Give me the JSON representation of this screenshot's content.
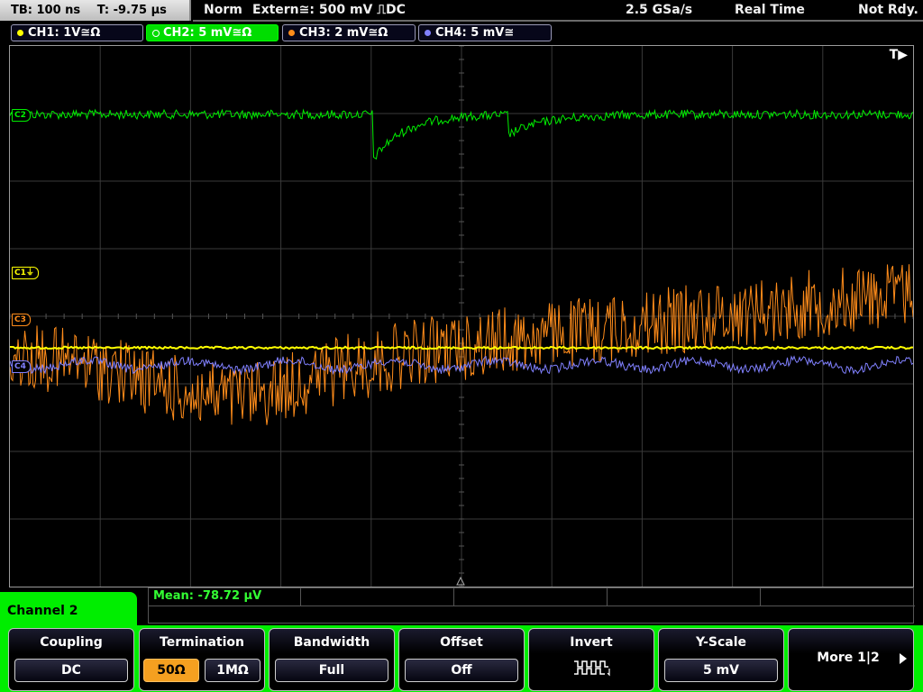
{
  "status": {
    "timebase": "TB: 100 ns",
    "trigger_time": "T: -9.75 µs",
    "trigger_mode": "Norm",
    "trigger_source": "Extern≅: 500 mV ⎍DC",
    "sample_rate": "2.5 GSa/s",
    "acq_mode": "Real Time",
    "state": "Not Rdy."
  },
  "channels": [
    {
      "label": "CH1: 1V≅Ω",
      "color": "#ffff00",
      "active": false
    },
    {
      "label": "CH2: 5 mV≅Ω",
      "color": "#00ee00",
      "active": true
    },
    {
      "label": "CH3: 2 mV≅Ω",
      "color": "#ff8c1a",
      "active": false
    },
    {
      "label": "CH4: 5 mV≅",
      "color": "#8080ff",
      "active": false
    }
  ],
  "screen": {
    "trigger_tag": "T▶",
    "markers": {
      "c1": "C1⏚",
      "c2": "C2",
      "c3": "C3",
      "c4": "C4"
    }
  },
  "measurement": {
    "mean": "Mean: -78.72 µV"
  },
  "menu": {
    "title": "Channel 2",
    "coupling": {
      "label": "Coupling",
      "value": "DC"
    },
    "termination": {
      "label": "Termination",
      "option_a": "50Ω",
      "option_b": "1MΩ"
    },
    "bandwidth": {
      "label": "Bandwidth",
      "value": "Full"
    },
    "offset": {
      "label": "Offset",
      "value": "Off"
    },
    "invert": {
      "label": "Invert",
      "icon": "invert-waveform-icon"
    },
    "yscale": {
      "label": "Y-Scale",
      "value": "5 mV"
    },
    "more": {
      "label": "More 1|2",
      "icon": "arrow-right-icon"
    }
  },
  "colors": {
    "ch1": "#ffff00",
    "ch2": "#00ee00",
    "ch3": "#ff8c1a",
    "ch4": "#8080ff",
    "menu_accent": "#00ee00",
    "selected_option": "#f5a020"
  }
}
